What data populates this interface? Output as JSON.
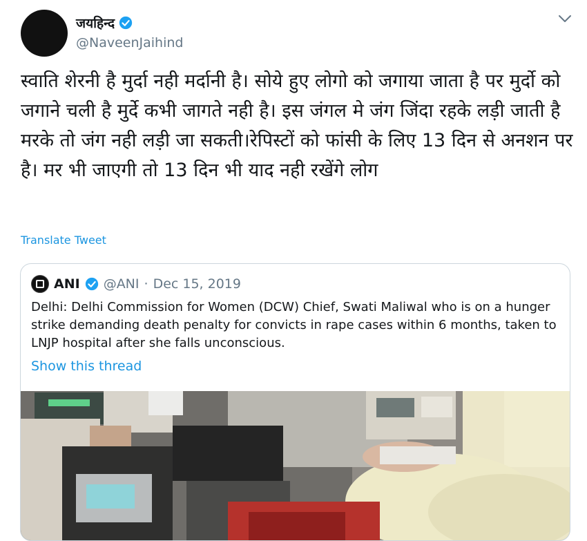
{
  "author": {
    "display_name": "जयहिन्द",
    "handle": "@NaveenJaihind",
    "verified_icon": "verified-badge-icon"
  },
  "tweet": {
    "text": "स्वाति शेरनी है मुर्दा नही मर्दानी है। सोये हुए लोगो को जगाया जाता है पर मुर्दो को जगाने चली है मुर्दे कभी जागते नही है। इस जंगल मे जंग जिंदा रहके लड़ी जाती है मरके तो जंग नही लड़ी जा सकती।रेपिस्टों को फांसी के लिए 13 दिन से अनशन पर है। मर भी जाएगी तो 13 दिन भी याद नही रखेंगे लोग",
    "translate_label": "Translate Tweet"
  },
  "quote": {
    "name": "ANI",
    "handle": "@ANI",
    "separator": "·",
    "date": "Dec 15, 2019",
    "text": "Delhi: Delhi Commission for Women (DCW) Chief, Swati Maliwal who is on a hunger strike demanding death penalty for convicts in rape cases within 6 months, taken to LNJP hospital after she falls unconscious.",
    "show_thread_label": "Show this thread"
  },
  "colors": {
    "link": "#1b95e0",
    "secondary_text": "#657786",
    "border": "#ccd6dd",
    "verified": "#1da1f2"
  }
}
